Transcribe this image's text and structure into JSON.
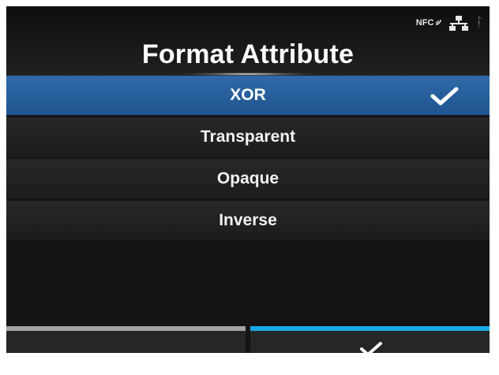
{
  "header": {
    "title": "Format Attribute"
  },
  "status": {
    "nfc_label": "NFC"
  },
  "options": [
    {
      "label": "XOR",
      "selected": true
    },
    {
      "label": "Transparent",
      "selected": false
    },
    {
      "label": "Opaque",
      "selected": false
    },
    {
      "label": "Inverse",
      "selected": false
    }
  ],
  "footer": {
    "left_button": {
      "indicator_color": "#a3a3a3"
    },
    "right_button": {
      "icon": "checkmark-icon",
      "indicator_color": "#1aa9e6"
    }
  },
  "colors": {
    "selected_row": "#2a64a3",
    "background": "#141414",
    "accent": "#1aa9e6"
  }
}
